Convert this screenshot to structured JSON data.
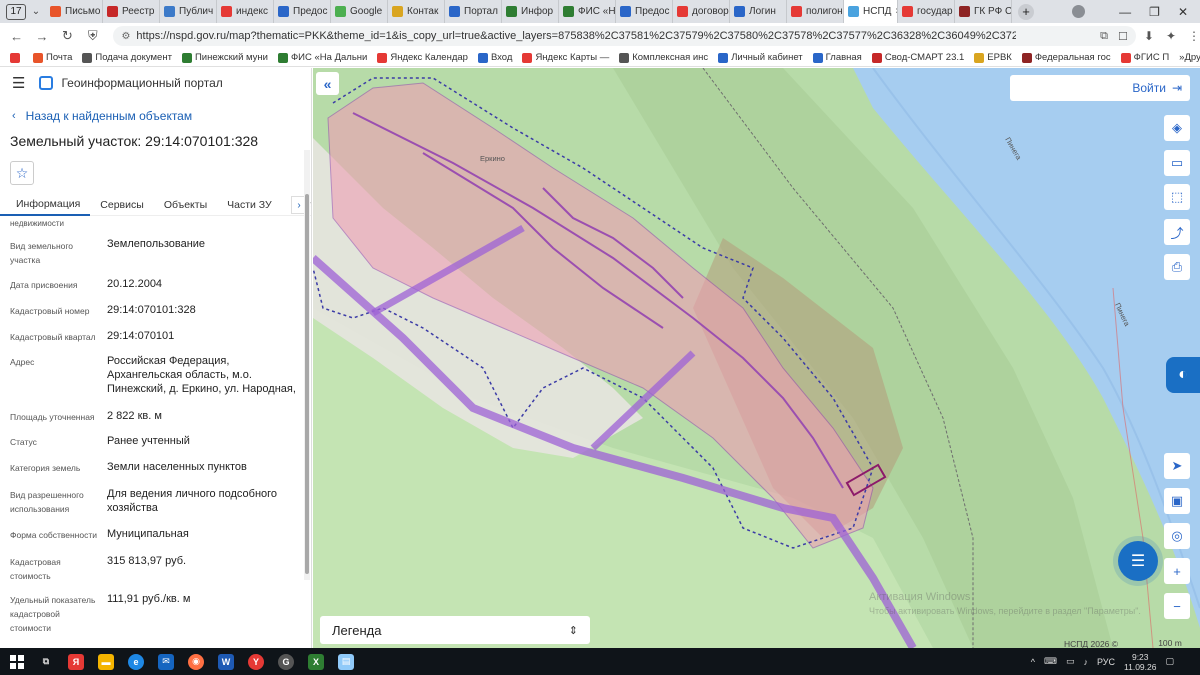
{
  "browser": {
    "tab_counter": "17",
    "tabs": [
      {
        "label": "Письмо",
        "color": "#e8542a"
      },
      {
        "label": "Реестр",
        "color": "#c62828"
      },
      {
        "label": "Публич",
        "color": "#3c7ac9"
      },
      {
        "label": "индекс",
        "color": "#e53935"
      },
      {
        "label": "Предос",
        "color": "#2a66c8"
      },
      {
        "label": "Google",
        "color": "#4caf50"
      },
      {
        "label": "Контак",
        "color": "#d9a520"
      },
      {
        "label": "Портал",
        "color": "#2a66c8"
      },
      {
        "label": "Инфор",
        "color": "#2e7d32"
      },
      {
        "label": "ФИС «Н",
        "color": "#2e7d32"
      },
      {
        "label": "Предос",
        "color": "#2a66c8"
      },
      {
        "label": "договор",
        "color": "#e53935"
      },
      {
        "label": "Логин",
        "color": "#2a66c8"
      },
      {
        "label": "полигон",
        "color": "#e53935"
      }
    ],
    "active_tab": {
      "label": "НСПД",
      "close": "×"
    },
    "tabs_after": [
      {
        "label": "государ",
        "color": "#e53935"
      },
      {
        "label": "ГК РФ С",
        "color": "#8e2424"
      }
    ],
    "new_tab": "+",
    "url": "https://nspd.gov.ru/map?thematic=PKK&theme_id=1&is_copy_url=true&active_layers=875838%2C37581%2C37579%2C37580%2C37578%2C37577%2C36328%2C36049%2C37294%2C36048%2C875882%2C875831...",
    "bookmarks": [
      {
        "label": "Почта",
        "color": "#e8542a"
      },
      {
        "label": "Подача документ",
        "color": "#555555"
      },
      {
        "label": "Пинежский муни",
        "color": "#2e7d32"
      },
      {
        "label": "ФИС «На Дальни",
        "color": "#2e7d32"
      },
      {
        "label": "Яндекс Календар",
        "color": "#e53935"
      },
      {
        "label": "Вход",
        "color": "#2a66c8"
      },
      {
        "label": "Яндекс Карты — ",
        "color": "#e53935"
      },
      {
        "label": "Комплексная инс",
        "color": "#555555"
      },
      {
        "label": "Личный кабинет",
        "color": "#2a66c8"
      },
      {
        "label": "Главная",
        "color": "#2a66c8"
      },
      {
        "label": "Свод-СМАРТ 23.1",
        "color": "#c62828"
      },
      {
        "label": "ЕРВК",
        "color": "#d9a520"
      },
      {
        "label": "Федеральная гос",
        "color": "#8e2424"
      },
      {
        "label": "ФГИС П",
        "color": "#e53935"
      }
    ],
    "bookmarks_more": "»",
    "other_bookmarks": "Другие закладки"
  },
  "panel": {
    "portal_title": "Геоинформационный портал",
    "back_link": "Назад к найденным объектам",
    "object_title": "Земельный участок: 29:14:070101:328",
    "tabs": [
      "Информация",
      "Сервисы",
      "Объекты",
      "Части ЗУ",
      "Состав"
    ],
    "tab_arrow": "›",
    "cut_label": "недвижимости",
    "properties": [
      {
        "label": "Вид земельного участка",
        "value": "Землепользование"
      },
      {
        "label": "Дата присвоения",
        "value": "20.12.2004"
      },
      {
        "label": "Кадастровый номер",
        "value": "29:14:070101:328"
      },
      {
        "label": "Кадастровый квартал",
        "value": "29:14:070101"
      },
      {
        "label": "Адрес",
        "value": "Российская Федерация, Архангельская область, м.о. Пинежский, д. Еркино, ул. Народная,"
      },
      {
        "label": "Площадь уточненная",
        "value": "2 822 кв. м"
      },
      {
        "label": "Статус",
        "value": "Ранее учтенный"
      },
      {
        "label": "Категория земель",
        "value": "Земли населенных пунктов"
      },
      {
        "label": "Вид разрешенного использования",
        "value": "Для ведения личного подсобного хозяйства"
      },
      {
        "label": "Форма собственности",
        "value": "Муниципальная"
      },
      {
        "label": "Кадастровая стоимость",
        "value": "315 813,97 руб."
      },
      {
        "label": "Удельный показатель кадастровой стоимости",
        "value": "111,91 руб./кв. м"
      }
    ]
  },
  "map": {
    "login": "Войти",
    "legend": "Легенда",
    "village_label": "Еркино",
    "river_label_1": "Пинега",
    "river_label_2": "Пинега",
    "copyright": "НСПД 2026 ©",
    "scale": "100 m",
    "watermark": "Активация Windows",
    "watermark_sub": "Чтобы активировать Windows, перейдите в раздел \"Параметры\"."
  },
  "taskbar": {
    "lang": "РУС",
    "time": "9:23",
    "date": "11.09.26"
  }
}
